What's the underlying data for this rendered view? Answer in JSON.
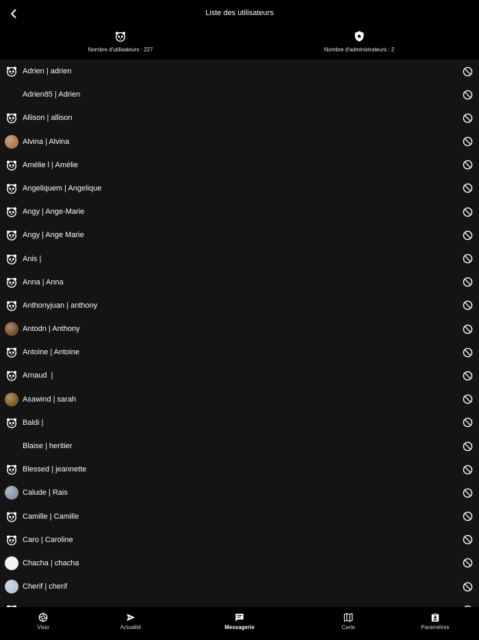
{
  "header": {
    "title": "Liste des utilisateurs",
    "users_count_label": "Nombre d'utilisateurs : 227",
    "admins_count_label": "Nombre d'administrateurs : 2"
  },
  "users": [
    {
      "label": "Adrien | adrien",
      "avatar": "panda-icon"
    },
    {
      "label": "Adrien85 | Adrien",
      "avatar": "none"
    },
    {
      "label": "Allison | allison",
      "avatar": "panda-icon"
    },
    {
      "label": "Alvina | Alvina",
      "avatar": "photo",
      "color": "#b07a4e"
    },
    {
      "label": "Amélie l | Amélie",
      "avatar": "panda-icon"
    },
    {
      "label": "Angeliquem | Angelique",
      "avatar": "panda-icon"
    },
    {
      "label": "Angy | Ange-Marie",
      "avatar": "panda-icon"
    },
    {
      "label": "Angy | Ange Marie",
      "avatar": "panda-icon"
    },
    {
      "label": "Anis |",
      "avatar": "panda-icon"
    },
    {
      "label": "Anna | Anna",
      "avatar": "panda-icon"
    },
    {
      "label": "Anthonyjuan | anthony",
      "avatar": "panda-icon"
    },
    {
      "label": "Antodn | Anthony",
      "avatar": "photo",
      "color": "#7a5230"
    },
    {
      "label": "Antoine | Antoine",
      "avatar": "panda-icon"
    },
    {
      "label": "Arnaud  |",
      "avatar": "panda-icon"
    },
    {
      "label": "Asawind | sarah",
      "avatar": "photo",
      "color": "#8a5a2c"
    },
    {
      "label": "Baldi |",
      "avatar": "panda-icon"
    },
    {
      "label": "Blaise | heritier",
      "avatar": "none"
    },
    {
      "label": "Blessed | jeannette",
      "avatar": "panda-icon"
    },
    {
      "label": "Calude | Rais",
      "avatar": "photo",
      "color": "#8a96a8"
    },
    {
      "label": "Camille | Camille",
      "avatar": "panda-icon"
    },
    {
      "label": "Caro | Caroline",
      "avatar": "panda-icon"
    },
    {
      "label": "Chacha | chacha",
      "avatar": "photo",
      "color": "#f2f2f2"
    },
    {
      "label": "Cherif | cherif",
      "avatar": "photo",
      "color": "#b8c8d6"
    },
    {
      "label": "",
      "avatar": "panda-icon"
    }
  ],
  "row_action_icon": "block-icon",
  "nav": [
    {
      "label": "Visio",
      "icon": "aperture-icon",
      "active": false
    },
    {
      "label": "Actualité",
      "icon": "send-icon",
      "active": false
    },
    {
      "label": "Messagerie",
      "icon": "chat-icon",
      "active": true
    },
    {
      "label": "Carte",
      "icon": "map-icon",
      "active": false
    },
    {
      "label": "Paramètres",
      "icon": "badge-icon",
      "active": false
    }
  ],
  "colors": {
    "background": "#141414",
    "bars": "#000000",
    "text": "#ffffff"
  }
}
